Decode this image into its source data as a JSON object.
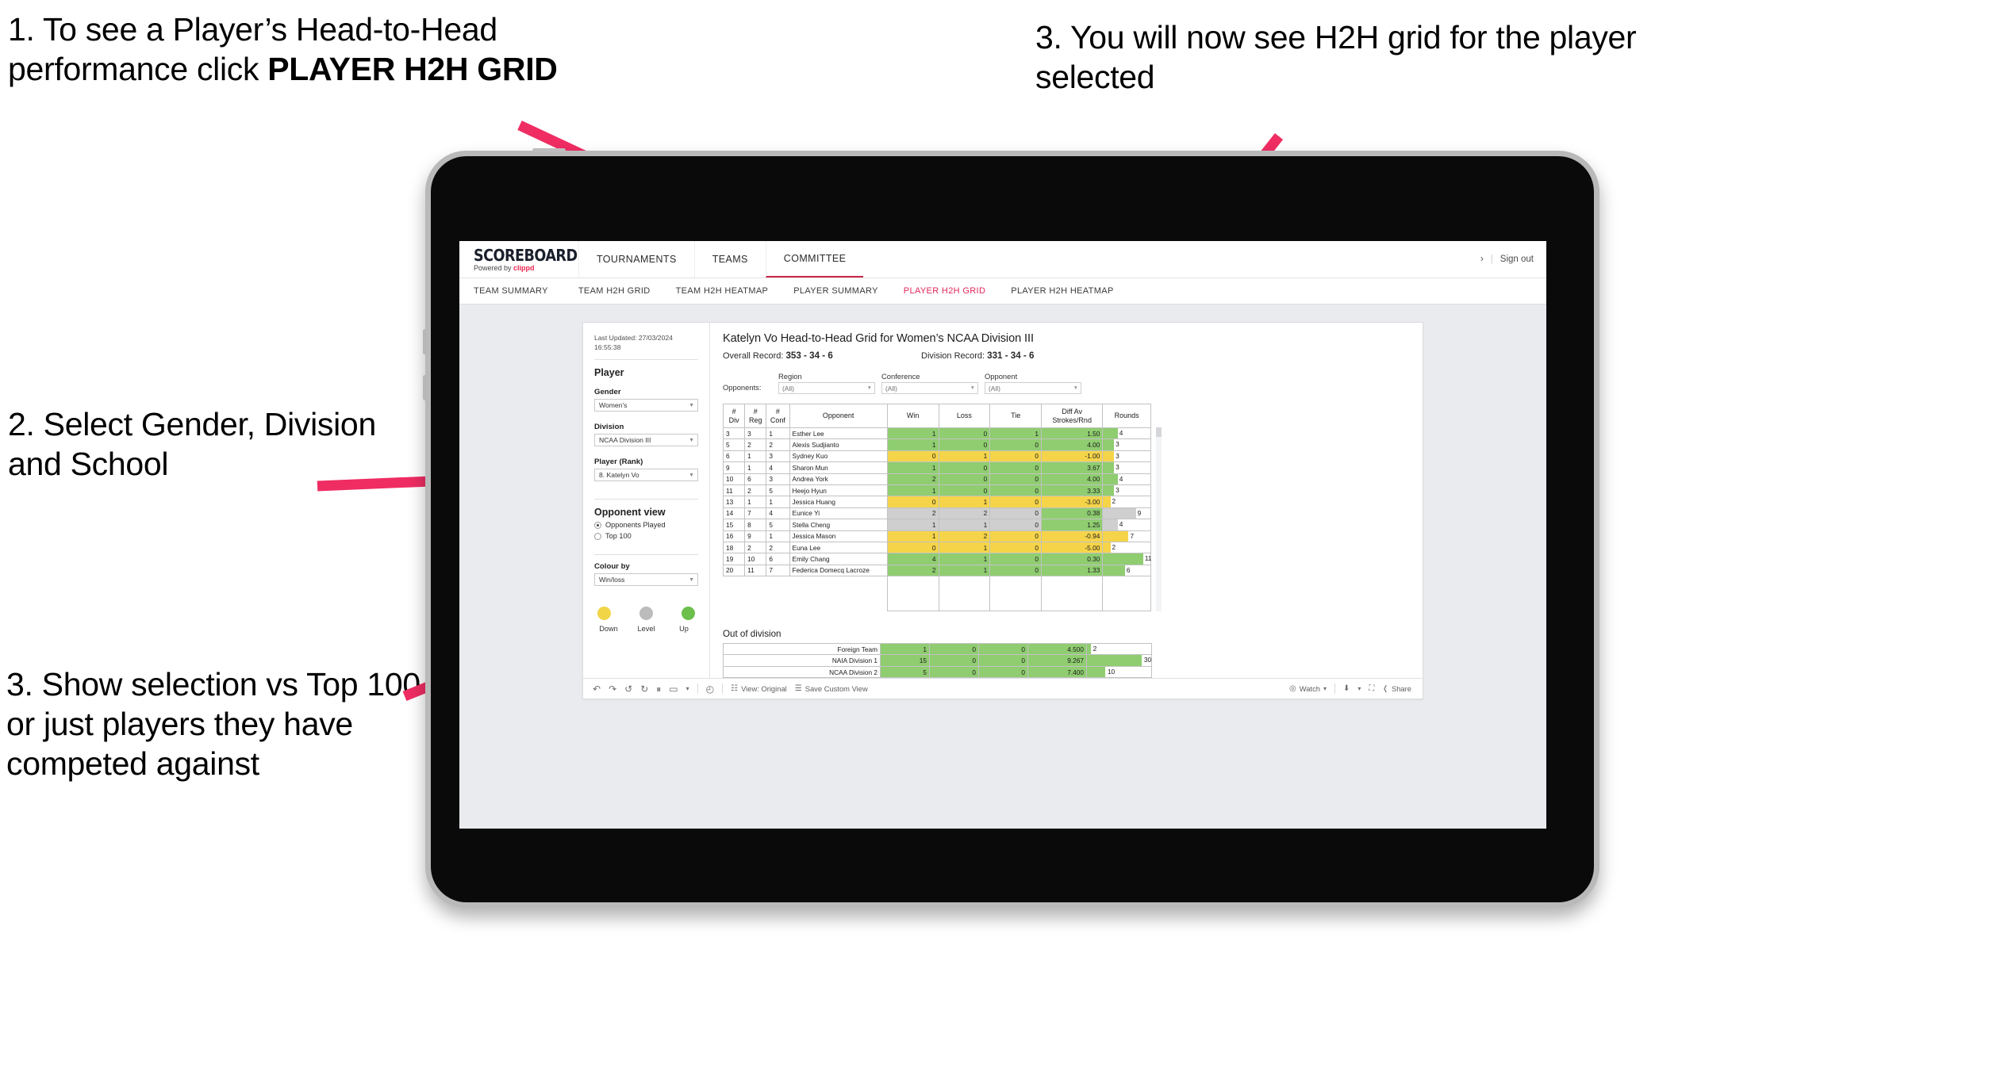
{
  "annotations": [
    {
      "id": "anno-1",
      "text_plain": "1. To see a Player’s Head-to-Head performance click ",
      "text_bold": "PLAYER H2H GRID"
    },
    {
      "id": "anno-2",
      "text": "2. Select Gender, Division and School"
    },
    {
      "id": "anno-3",
      "text": "3. Show selection vs Top 100 or just players they have competed against"
    },
    {
      "id": "anno-4",
      "text": "3. You will now see H2H grid for the player selected"
    }
  ],
  "colors": {
    "arrow": "#ef2d63",
    "accent": "#e0265a",
    "brand": "#e8254f",
    "win": "#8fcd70",
    "loss": "#f5d44a",
    "tie": "#cfcfcf"
  },
  "app": {
    "logo": "SCOREBOARD",
    "logo_sub_prefix": "Powered by ",
    "logo_sub_brand": "clippd",
    "main_nav": [
      {
        "label": "TOURNAMENTS",
        "active": false
      },
      {
        "label": "TEAMS",
        "active": false
      },
      {
        "label": "COMMITTEE",
        "active": true
      }
    ],
    "account_chevron": "›",
    "sign_out": "Sign out",
    "sub_nav": [
      {
        "label": "TEAM SUMMARY",
        "active": false
      },
      {
        "label": "TEAM H2H GRID",
        "active": false
      },
      {
        "label": "TEAM H2H HEATMAP",
        "active": false
      },
      {
        "label": "PLAYER SUMMARY",
        "active": false
      },
      {
        "label": "PLAYER H2H GRID",
        "active": true
      },
      {
        "label": "PLAYER H2H HEATMAP",
        "active": false
      }
    ]
  },
  "sidebar": {
    "last_updated": "Last Updated: 27/03/2024 16:55:38",
    "player_heading": "Player",
    "gender_label": "Gender",
    "gender_value": "Women's",
    "division_label": "Division",
    "division_value": "NCAA Division III",
    "player_rank_label": "Player (Rank)",
    "player_rank_value": "8. Katelyn Vo",
    "opponent_view_heading": "Opponent view",
    "opponent_view_options": [
      {
        "label": "Opponents Played",
        "selected": true
      },
      {
        "label": "Top 100",
        "selected": false
      }
    ],
    "colour_by_label": "Colour by",
    "colour_by_value": "Win/loss",
    "legend": [
      {
        "label": "Down",
        "color": "#f1d546"
      },
      {
        "label": "Level",
        "color": "#bcbcbc"
      },
      {
        "label": "Up",
        "color": "#6cbf4b"
      }
    ]
  },
  "main": {
    "title": "Katelyn Vo Head-to-Head Grid for Women’s NCAA Division III",
    "overall_record_label": "Overall Record: ",
    "overall_record_value": "353 - 34 - 6",
    "division_record_label": "Division Record: ",
    "division_record_value": "331 - 34 - 6",
    "opponents_label": "Opponents:",
    "filters": [
      {
        "caption": "Region",
        "value": "(All)"
      },
      {
        "caption": "Conference",
        "value": "(All)"
      },
      {
        "caption": "Opponent",
        "value": "(All)"
      }
    ],
    "columns": [
      "# Div",
      "# Reg",
      "# Conf",
      "Opponent",
      "Win",
      "Loss",
      "Tie",
      "Diff Av Strokes/Rnd",
      "Rounds"
    ],
    "rows": [
      {
        "div": "3",
        "reg": "3",
        "conf": "1",
        "opponent": "Esther Lee",
        "win": "1",
        "loss": "0",
        "tie": "1",
        "diff": "1.50",
        "rounds": "4",
        "state": "win"
      },
      {
        "div": "5",
        "reg": "2",
        "conf": "2",
        "opponent": "Alexis Sudjianto",
        "win": "1",
        "loss": "0",
        "tie": "0",
        "diff": "4.00",
        "rounds": "3",
        "state": "win"
      },
      {
        "div": "6",
        "reg": "1",
        "conf": "3",
        "opponent": "Sydney Kuo",
        "win": "0",
        "loss": "1",
        "tie": "0",
        "diff": "-1.00",
        "rounds": "3",
        "state": "loss"
      },
      {
        "div": "9",
        "reg": "1",
        "conf": "4",
        "opponent": "Sharon Mun",
        "win": "1",
        "loss": "0",
        "tie": "0",
        "diff": "3.67",
        "rounds": "3",
        "state": "win"
      },
      {
        "div": "10",
        "reg": "6",
        "conf": "3",
        "opponent": "Andrea York",
        "win": "2",
        "loss": "0",
        "tie": "0",
        "diff": "4.00",
        "rounds": "4",
        "state": "win"
      },
      {
        "div": "11",
        "reg": "2",
        "conf": "5",
        "opponent": "Heejo Hyun",
        "win": "1",
        "loss": "0",
        "tie": "0",
        "diff": "3.33",
        "rounds": "3",
        "state": "win"
      },
      {
        "div": "13",
        "reg": "1",
        "conf": "1",
        "opponent": "Jessica Huang",
        "win": "0",
        "loss": "1",
        "tie": "0",
        "diff": "-3.00",
        "rounds": "2",
        "state": "loss"
      },
      {
        "div": "14",
        "reg": "7",
        "conf": "4",
        "opponent": "Eunice Yi",
        "win": "2",
        "loss": "2",
        "tie": "0",
        "diff": "0.38",
        "rounds": "9",
        "state": "tie"
      },
      {
        "div": "15",
        "reg": "8",
        "conf": "5",
        "opponent": "Stella Cheng",
        "win": "1",
        "loss": "1",
        "tie": "0",
        "diff": "1.25",
        "rounds": "4",
        "state": "tie"
      },
      {
        "div": "16",
        "reg": "9",
        "conf": "1",
        "opponent": "Jessica Mason",
        "win": "1",
        "loss": "2",
        "tie": "0",
        "diff": "-0.94",
        "rounds": "7",
        "state": "loss"
      },
      {
        "div": "18",
        "reg": "2",
        "conf": "2",
        "opponent": "Euna Lee",
        "win": "0",
        "loss": "1",
        "tie": "0",
        "diff": "-5.00",
        "rounds": "2",
        "state": "loss"
      },
      {
        "div": "19",
        "reg": "10",
        "conf": "6",
        "opponent": "Emily Chang",
        "win": "4",
        "loss": "1",
        "tie": "0",
        "diff": "0.30",
        "rounds": "11",
        "state": "win"
      },
      {
        "div": "20",
        "reg": "11",
        "conf": "7",
        "opponent": "Federica Domecq Lacroze",
        "win": "2",
        "loss": "1",
        "tie": "0",
        "diff": "1.33",
        "rounds": "6",
        "state": "win"
      }
    ],
    "out_of_division_title": "Out of division",
    "out_of_division_rows": [
      {
        "name": "Foreign Team",
        "win": "1",
        "loss": "0",
        "tie": "0",
        "diff": "4.500",
        "rounds": "2",
        "state": "win"
      },
      {
        "name": "NAIA Division 1",
        "win": "15",
        "loss": "0",
        "tie": "0",
        "diff": "9.267",
        "rounds": "30",
        "state": "win"
      },
      {
        "name": "NCAA Division 2",
        "win": "5",
        "loss": "0",
        "tie": "0",
        "diff": "7.400",
        "rounds": "10",
        "state": "win"
      }
    ]
  },
  "toolbar": {
    "undo_icon": "↶",
    "redo_icon": "↷",
    "revert_icon": "↺",
    "refresh_icon": "↻",
    "pause_icon": "⏸",
    "device_icon": "▭",
    "device_caret": "▾",
    "clock_icon": "◴",
    "view_original": "View: Original",
    "view_icon": "☷",
    "save_custom_view": "Save Custom View",
    "save_icon": "☰",
    "watch": "Watch",
    "watch_icon": "◎",
    "watch_caret": "▾",
    "download_icon": "⬇",
    "download_caret": "▾",
    "fullscreen_icon": "⛶",
    "share": "Share",
    "share_icon": "❬"
  }
}
